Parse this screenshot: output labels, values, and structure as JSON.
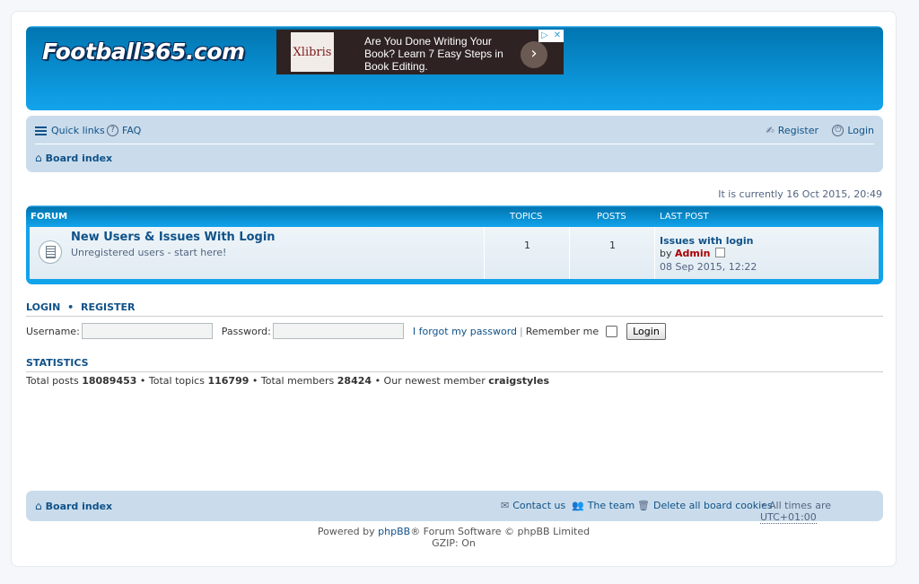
{
  "header": {
    "logo_text": "Football365.com",
    "ad": {
      "brand": "Xlibris",
      "text": "Are You Done Writing Your Book? Learn 7 Easy Steps in Book Editing.",
      "arrow": "›",
      "adchoices": "▷",
      "close": "✕"
    }
  },
  "nav": {
    "quick_links": "Quick links",
    "faq": "FAQ",
    "register": "Register",
    "login": "Login",
    "board_index": "Board index"
  },
  "current_time": "It is currently 16 Oct 2015, 20:49",
  "forum_table": {
    "headers": {
      "forum": "FORUM",
      "topics": "TOPICS",
      "posts": "POSTS",
      "last_post": "LAST POST"
    },
    "rows": [
      {
        "title": "New Users & Issues With Login",
        "description": "Unregistered users - start here!",
        "topics": "1",
        "posts": "1",
        "last_post_title": "Issues with login",
        "by": "by",
        "author": "Admin",
        "date": "08 Sep 2015, 12:22"
      }
    ]
  },
  "login_section": {
    "heading_login": "LOGIN",
    "heading_sep": "•",
    "heading_register": "REGISTER",
    "username_label": "Username:",
    "password_label": "Password:",
    "username_value": "",
    "password_value": "",
    "forgot": "I forgot my password",
    "pipe": "|",
    "remember": "Remember me",
    "login_button": "Login"
  },
  "statistics": {
    "heading": "STATISTICS",
    "total_posts_label": "Total posts",
    "total_posts": "18089453",
    "total_topics_label": "• Total topics",
    "total_topics": "116799",
    "total_members_label": "• Total members",
    "total_members": "28424",
    "newest_label": "• Our newest member",
    "newest_member": "craigstyles"
  },
  "footer": {
    "board_index": "Board index",
    "contact": "Contact us",
    "team": "The team",
    "delete_cookies": "Delete all board cookies",
    "times_sep": "•",
    "times_label": "All times are",
    "timezone": "UTC+01:00",
    "powered_prefix": "Powered by",
    "phpbb": "phpBB",
    "powered_suffix": "® Forum Software © phpBB Limited",
    "gzip": "GZIP: On"
  }
}
